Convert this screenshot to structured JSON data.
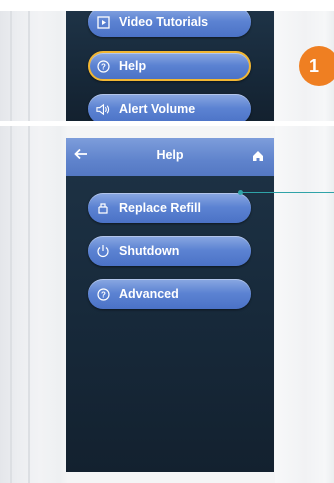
{
  "top_screen": {
    "menu_items": [
      {
        "label": "Video Tutorials",
        "icon": "video-icon"
      },
      {
        "label": "Help",
        "icon": "question-circle-icon",
        "selected": true
      },
      {
        "label": "Alert Volume",
        "icon": "speaker-icon"
      }
    ],
    "highlight_color": "#f2b733"
  },
  "step_badge": {
    "number": "1",
    "color": "#ef7f22"
  },
  "help_screen": {
    "header": {
      "title": "Help",
      "back_icon": "back-arrow-icon",
      "home_icon": "home-icon"
    },
    "menu_items": [
      {
        "label": "Replace Refill",
        "icon": "refill-icon"
      },
      {
        "label": "Shutdown",
        "icon": "power-icon"
      },
      {
        "label": "Advanced",
        "icon": "question-circle-icon"
      }
    ]
  },
  "colors": {
    "button_blue": "#5b82d2",
    "screen_dark": "#17293a",
    "callout_teal": "#2fa3a8"
  }
}
